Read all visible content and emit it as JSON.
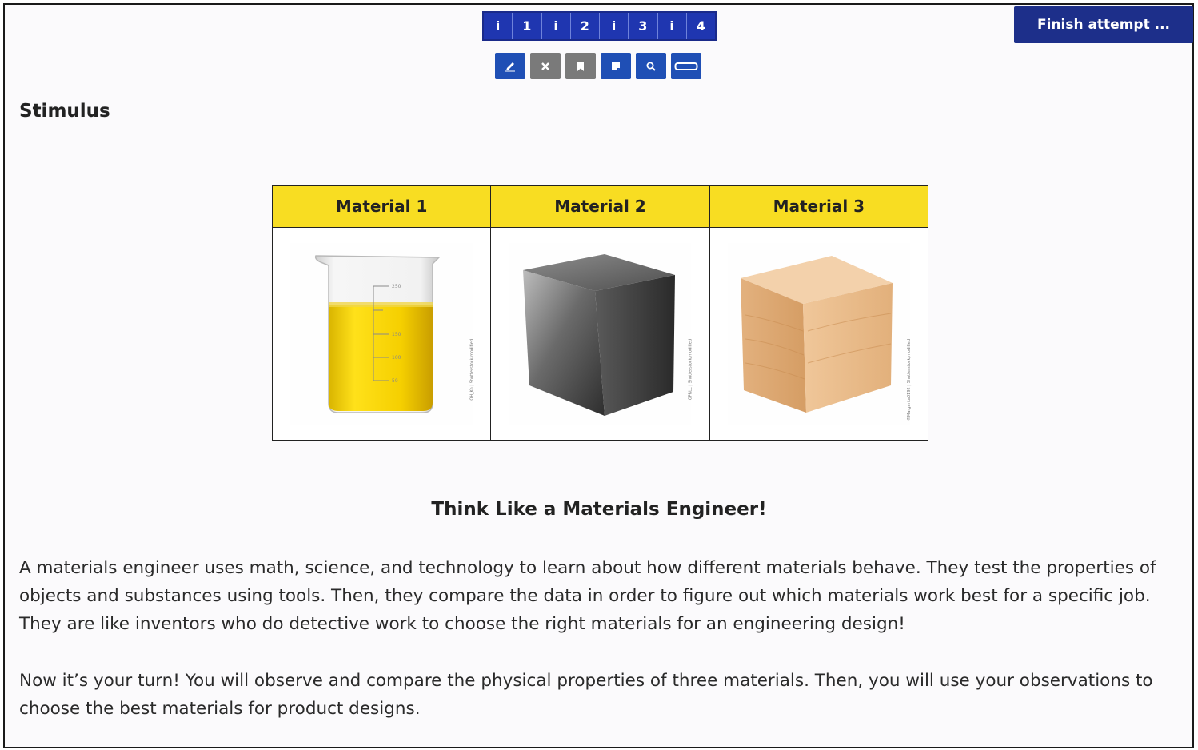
{
  "question_nav": {
    "items": [
      "i",
      "1",
      "i",
      "2",
      "i",
      "3",
      "i",
      "4"
    ]
  },
  "tools": [
    {
      "name": "pencil-icon",
      "color": "#1f4fb5"
    },
    {
      "name": "close-icon",
      "color": "#7a7a7a"
    },
    {
      "name": "bookmark-icon",
      "color": "#7a7a7a"
    },
    {
      "name": "note-icon",
      "color": "#1f4fb5"
    },
    {
      "name": "zoom-icon",
      "color": "#1f4fb5"
    },
    {
      "name": "line-reader-icon",
      "color": "#1f4fb5"
    }
  ],
  "finish_button": {
    "label": "Finish attempt ..."
  },
  "stimulus": {
    "heading": "Stimulus"
  },
  "materials_table": {
    "headers": [
      "Material 1",
      "Material 2",
      "Material 3"
    ],
    "header_color": "#f8dd22",
    "images": [
      {
        "name": "beaker-liquid-image",
        "credit": "OH_Ko | Shutterstock/modified"
      },
      {
        "name": "metal-cube-image",
        "credit": "OPRLL | Shutterstock/modified"
      },
      {
        "name": "wood-cube-image",
        "credit": "©Margarita0192 | Shutterstock/modified"
      }
    ]
  },
  "section": {
    "title": "Think Like a Materials Engineer!",
    "paragraphs": [
      "A materials engineer uses math, science, and technology to learn about how different materials behave. They test the properties of objects and substances using tools. Then, they compare the data in order to figure out which materials work best for a specific job. They are like inventors who do detective work to choose the right materials for an engineering design!",
      "Now it’s your turn! You will observe and compare the physical properties of three materials. Then, you will use your observations to choose the best materials for product designs."
    ]
  }
}
